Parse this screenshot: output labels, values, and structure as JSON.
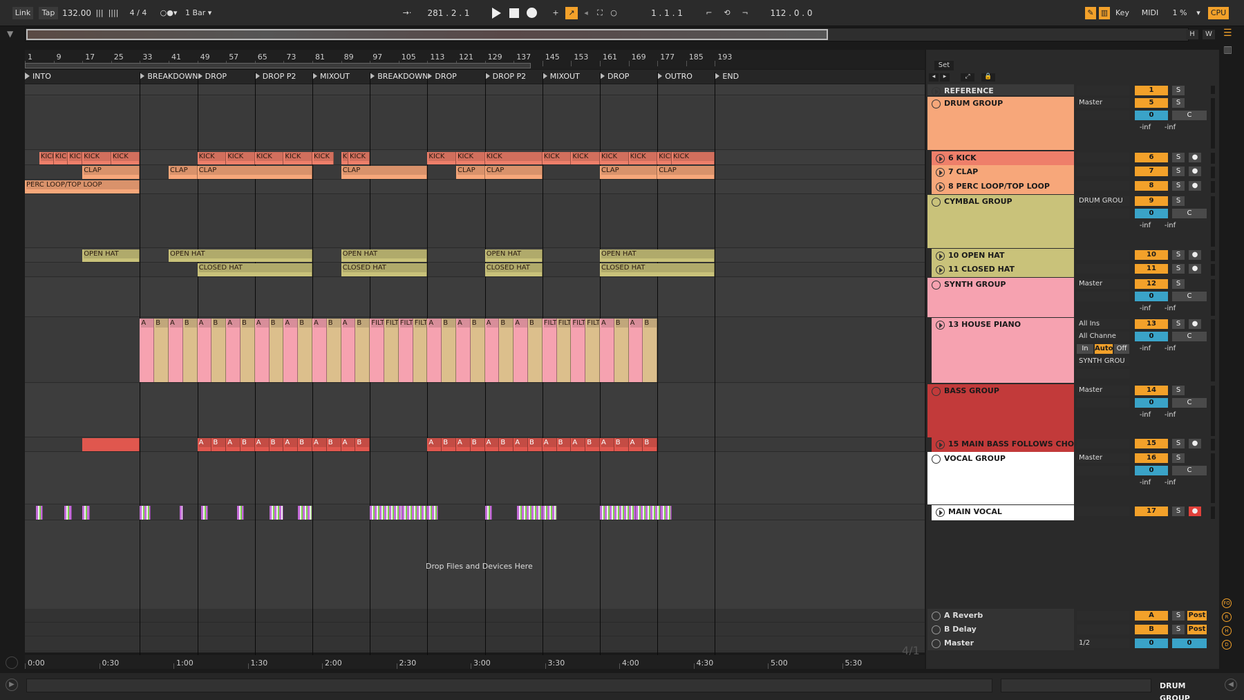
{
  "toolbar": {
    "link": "Link",
    "tap": "Tap",
    "tempo": "132.00",
    "sig": "4 / 4",
    "quant": "1 Bar",
    "pos": "281 .  2 .  1",
    "loop_start": "1 .  1 .  1",
    "loop_len": "112 .  0 .  0",
    "key": "Key",
    "midi": "MIDI",
    "cpu_pct": "1 %",
    "cpu": "CPU"
  },
  "overview": {
    "h": "H",
    "w": "W"
  },
  "bars": [
    "1",
    "9",
    "17",
    "25",
    "33",
    "41",
    "49",
    "57",
    "65",
    "73",
    "81",
    "89",
    "97",
    "105",
    "113",
    "121",
    "129",
    "137",
    "145",
    "153",
    "161",
    "169",
    "177",
    "185",
    "193"
  ],
  "markers": [
    "INTO",
    "BREAKDOWN",
    "DROP",
    "DROP P2",
    "MIXOUT",
    "BREAKDOWN",
    "DROP",
    "DROP P2",
    "MIXOUT",
    "DROP",
    "OUTRO",
    "END"
  ],
  "set_label": "Set",
  "drop_hint": "Drop Files and Devices Here",
  "times": [
    "0:00",
    "0:30",
    "1:00",
    "1:30",
    "2:00",
    "2:30",
    "3:00",
    "3:30",
    "4:00",
    "4:30",
    "5:00",
    "5:30"
  ],
  "zoom": "4/1",
  "tracks": [
    {
      "name": "REFERENCE",
      "num": "1"
    },
    {
      "name": "DRUM GROUP",
      "num": "5",
      "route": "Master",
      "vol": "0",
      "pan": "C"
    },
    {
      "name": "6 KICK",
      "num": "6"
    },
    {
      "name": "7 CLAP",
      "num": "7"
    },
    {
      "name": "8 PERC LOOP/TOP LOOP",
      "num": "8"
    },
    {
      "name": "CYMBAL GROUP",
      "num": "9",
      "route": "DRUM GROU",
      "vol": "0",
      "pan": "C"
    },
    {
      "name": "10 OPEN HAT",
      "num": "10"
    },
    {
      "name": "11 CLOSED HAT",
      "num": "11"
    },
    {
      "name": "SYNTH GROUP",
      "num": "12",
      "route": "Master",
      "vol": "0",
      "pan": "C"
    },
    {
      "name": "13 HOUSE PIANO",
      "num": "13",
      "input": "All Ins",
      "channel": "All Channe",
      "route": "SYNTH GROU",
      "vol": "0",
      "pan": "C",
      "mon_in": "In",
      "mon_auto": "Auto",
      "mon_off": "Off"
    },
    {
      "name": "BASS GROUP",
      "num": "14",
      "route": "Master",
      "vol": "0",
      "pan": "C"
    },
    {
      "name": "15 MAIN BASS FOLLOWS CHORDS",
      "num": "15"
    },
    {
      "name": "VOCAL GROUP",
      "num": "16",
      "route": "Master",
      "vol": "0",
      "pan": "C"
    },
    {
      "name": "MAIN VOCAL",
      "num": "17"
    }
  ],
  "returns": [
    {
      "name": "A Reverb",
      "num": "A",
      "post": "Post"
    },
    {
      "name": "B Delay",
      "num": "B",
      "post": "Post"
    },
    {
      "name": "Master",
      "num": "0",
      "route": "1/2",
      "vol": "0"
    }
  ],
  "common": {
    "solo": "S",
    "inf": "-inf"
  },
  "clip_labels": {
    "kick": "KICK",
    "clap": "CLAP",
    "perc": "PERC LOOP/TOP LOOP",
    "open": "OPEN HAT",
    "closed": "CLOSED HAT",
    "a": "A",
    "b": "B",
    "filt": "FILT"
  },
  "status": {
    "selected": "DRUM GROUP"
  },
  "side_letters": [
    "FO",
    "R",
    "H",
    "D"
  ],
  "colors": {
    "orange": "#f3a12a",
    "drum": "#f7a77a",
    "kick": "#ee7f6a",
    "cymbal": "#c9c27a",
    "synth": "#f6a2b0",
    "piano_a": "#f6a2b0",
    "piano_b": "#dcbf8c",
    "bass": "#c23a3a",
    "bass_clip": "#e0574e",
    "vocal": "#ffffff"
  }
}
